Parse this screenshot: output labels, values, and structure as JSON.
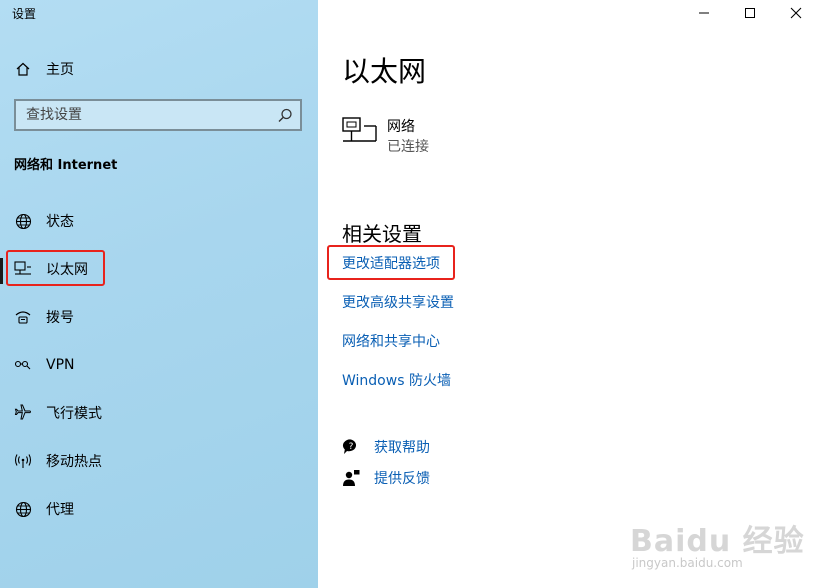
{
  "window": {
    "title": "设置"
  },
  "sidebar": {
    "home_label": "主页",
    "search_placeholder": "查找设置",
    "section_title": "网络和 Internet",
    "items": [
      {
        "label": "状态",
        "icon": "globe-icon"
      },
      {
        "label": "以太网",
        "icon": "ethernet-icon",
        "selected": true
      },
      {
        "label": "拨号",
        "icon": "dialup-icon"
      },
      {
        "label": "VPN",
        "icon": "vpn-icon"
      },
      {
        "label": "飞行模式",
        "icon": "airplane-icon"
      },
      {
        "label": "移动热点",
        "icon": "hotspot-icon"
      },
      {
        "label": "代理",
        "icon": "globe-icon"
      }
    ]
  },
  "main": {
    "title": "以太网",
    "network": {
      "name": "网络",
      "status": "已连接"
    },
    "related_title": "相关设置",
    "links": [
      "更改适配器选项",
      "更改高级共享设置",
      "网络和共享中心",
      "Windows 防火墙"
    ],
    "help": [
      {
        "label": "获取帮助",
        "icon": "help-chat-icon"
      },
      {
        "label": "提供反馈",
        "icon": "feedback-icon"
      }
    ]
  },
  "watermark": {
    "brand": "Baidu 经验",
    "url": "jingyan.baidu.com"
  },
  "colors": {
    "sidebar_bg": "#a8d6ee",
    "link": "#0a5fb4",
    "highlight_box": "#e8231c"
  }
}
